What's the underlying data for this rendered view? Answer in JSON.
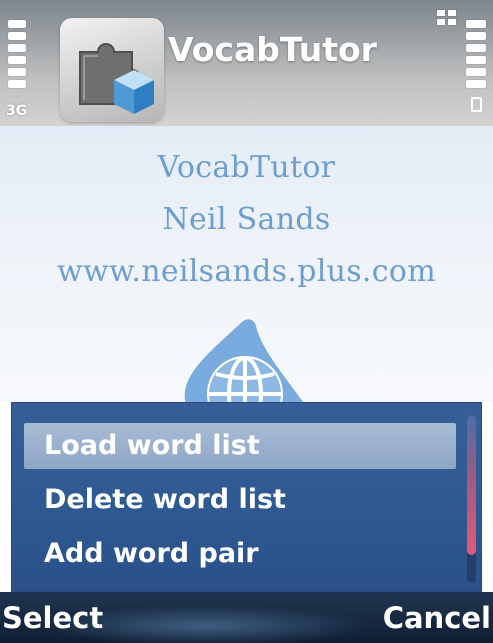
{
  "statusbar": {
    "network_type": "3G",
    "signal_icon": "signal-strength-icon",
    "battery_icon": "battery-icon",
    "app_icon": "puzzle-piece-icon",
    "multitask_icon": "app-grid-icon"
  },
  "app": {
    "title": "VocabTutor"
  },
  "splash": {
    "line1": "VocabTutor",
    "line2": "Neil Sands",
    "line3": "www.neilsands.plus.com",
    "logo_icon": "globe-logo-icon"
  },
  "menu": {
    "items": [
      {
        "label": "Load word list",
        "selected": true
      },
      {
        "label": "Delete word list",
        "selected": false
      },
      {
        "label": "Add word pair",
        "selected": false
      }
    ]
  },
  "softkeys": {
    "left": "Select",
    "right": "Cancel"
  },
  "colors": {
    "splash_text": "#6e9dd0",
    "menu_bg": "#2f5a93",
    "menu_highlight": "#9db2cf",
    "softkey_bg": "#1a2d45"
  }
}
